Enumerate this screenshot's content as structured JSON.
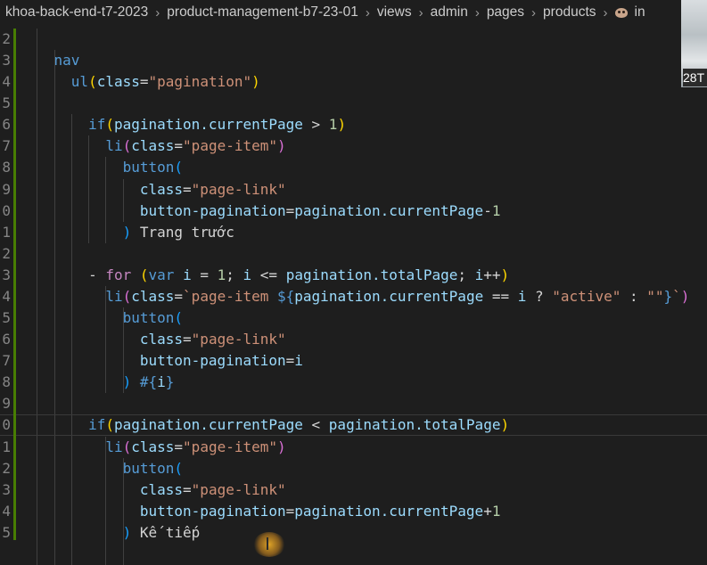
{
  "breadcrumb": {
    "items": [
      "khoa-back-end-t7-2023",
      "product-management-b7-23-01",
      "views",
      "admin",
      "pages",
      "products"
    ],
    "file_prefix": "in"
  },
  "overlay": {
    "label": "28T"
  },
  "editor": {
    "lines": [
      {
        "num": "2",
        "segs": []
      },
      {
        "num": "3",
        "segs": [
          [
            "    ",
            "tx"
          ],
          [
            "nav",
            "t"
          ]
        ]
      },
      {
        "num": "4",
        "segs": [
          [
            "      ",
            "tx"
          ],
          [
            "ul",
            "t"
          ],
          [
            "(",
            "y"
          ],
          [
            "class",
            "a"
          ],
          [
            "=",
            "tx"
          ],
          [
            "\"pagination\"",
            "s"
          ],
          [
            ")",
            "y"
          ]
        ]
      },
      {
        "num": "5",
        "segs": []
      },
      {
        "num": "6",
        "segs": [
          [
            "        ",
            "tx"
          ],
          [
            "if",
            "k"
          ],
          [
            "(",
            "y"
          ],
          [
            "pagination.currentPage",
            "a"
          ],
          [
            " > ",
            "tx"
          ],
          [
            "1",
            "n"
          ],
          [
            ")",
            "y"
          ]
        ]
      },
      {
        "num": "7",
        "segs": [
          [
            "          ",
            "tx"
          ],
          [
            "li",
            "t"
          ],
          [
            "(",
            "pl"
          ],
          [
            "class",
            "a"
          ],
          [
            "=",
            "tx"
          ],
          [
            "\"page-item\"",
            "s"
          ],
          [
            ")",
            "pl"
          ]
        ]
      },
      {
        "num": "8",
        "segs": [
          [
            "            ",
            "tx"
          ],
          [
            "button",
            "t"
          ],
          [
            "(",
            "bl"
          ]
        ]
      },
      {
        "num": "9",
        "segs": [
          [
            "              ",
            "tx"
          ],
          [
            "class",
            "a"
          ],
          [
            "=",
            "tx"
          ],
          [
            "\"page-link\"",
            "s"
          ]
        ]
      },
      {
        "num": "0",
        "segs": [
          [
            "              ",
            "tx"
          ],
          [
            "button-pagination",
            "a"
          ],
          [
            "=",
            "tx"
          ],
          [
            "pagination.currentPage",
            "a"
          ],
          [
            "-",
            "tx"
          ],
          [
            "1",
            "n"
          ]
        ]
      },
      {
        "num": "1",
        "segs": [
          [
            "            ",
            "tx"
          ],
          [
            ")",
            "bl"
          ],
          [
            " Trang trước",
            "tx"
          ]
        ]
      },
      {
        "num": "2",
        "segs": []
      },
      {
        "num": "3",
        "segs": [
          [
            "        ",
            "tx"
          ],
          [
            "- ",
            "tx"
          ],
          [
            "for",
            "p"
          ],
          [
            " ",
            "tx"
          ],
          [
            "(",
            "y"
          ],
          [
            "var",
            "k"
          ],
          [
            " ",
            "tx"
          ],
          [
            "i",
            "a"
          ],
          [
            " = ",
            "tx"
          ],
          [
            "1",
            "n"
          ],
          [
            "; ",
            "tx"
          ],
          [
            "i",
            "a"
          ],
          [
            " <= ",
            "tx"
          ],
          [
            "pagination.totalPage",
            "a"
          ],
          [
            "; ",
            "tx"
          ],
          [
            "i",
            "a"
          ],
          [
            "++",
            "tx"
          ],
          [
            ")",
            "y"
          ]
        ]
      },
      {
        "num": "4",
        "segs": [
          [
            "          ",
            "tx"
          ],
          [
            "li",
            "t"
          ],
          [
            "(",
            "pl"
          ],
          [
            "class",
            "a"
          ],
          [
            "=",
            "tx"
          ],
          [
            "`page-item ",
            "s"
          ],
          [
            "${",
            "k"
          ],
          [
            "pagination.currentPage",
            "a"
          ],
          [
            " == ",
            "tx"
          ],
          [
            "i",
            "a"
          ],
          [
            " ? ",
            "tx"
          ],
          [
            "\"active\"",
            "s"
          ],
          [
            " : ",
            "tx"
          ],
          [
            "\"\"",
            "s"
          ],
          [
            "}",
            "k"
          ],
          [
            "`",
            "s"
          ],
          [
            ")",
            "pl"
          ]
        ]
      },
      {
        "num": "5",
        "segs": [
          [
            "            ",
            "tx"
          ],
          [
            "button",
            "t"
          ],
          [
            "(",
            "bl"
          ]
        ]
      },
      {
        "num": "6",
        "segs": [
          [
            "              ",
            "tx"
          ],
          [
            "class",
            "a"
          ],
          [
            "=",
            "tx"
          ],
          [
            "\"page-link\"",
            "s"
          ]
        ]
      },
      {
        "num": "7",
        "segs": [
          [
            "              ",
            "tx"
          ],
          [
            "button-pagination",
            "a"
          ],
          [
            "=",
            "tx"
          ],
          [
            "i",
            "a"
          ]
        ]
      },
      {
        "num": "8",
        "segs": [
          [
            "            ",
            "tx"
          ],
          [
            ")",
            "bl"
          ],
          [
            " #{",
            "k"
          ],
          [
            "i",
            "a"
          ],
          [
            "}",
            "k"
          ]
        ]
      },
      {
        "num": "9",
        "segs": []
      },
      {
        "num": "0",
        "segs": [
          [
            "        ",
            "tx"
          ],
          [
            "if",
            "k"
          ],
          [
            "(",
            "y"
          ],
          [
            "pagination.currentPage",
            "a"
          ],
          [
            " < ",
            "tx"
          ],
          [
            "pagination.totalPage",
            "a"
          ],
          [
            ")",
            "y"
          ]
        ]
      },
      {
        "num": "1",
        "segs": [
          [
            "          ",
            "tx"
          ],
          [
            "li",
            "t"
          ],
          [
            "(",
            "pl"
          ],
          [
            "class",
            "a"
          ],
          [
            "=",
            "tx"
          ],
          [
            "\"page-item\"",
            "s"
          ],
          [
            ")",
            "pl"
          ]
        ]
      },
      {
        "num": "2",
        "segs": [
          [
            "            ",
            "tx"
          ],
          [
            "button",
            "t"
          ],
          [
            "(",
            "bl"
          ]
        ]
      },
      {
        "num": "3",
        "segs": [
          [
            "              ",
            "tx"
          ],
          [
            "class",
            "a"
          ],
          [
            "=",
            "tx"
          ],
          [
            "\"page-link\"",
            "s"
          ]
        ]
      },
      {
        "num": "4",
        "segs": [
          [
            "              ",
            "tx"
          ],
          [
            "button-pagination",
            "a"
          ],
          [
            "=",
            "tx"
          ],
          [
            "pagination.currentPage",
            "a"
          ],
          [
            "+",
            "tx"
          ],
          [
            "1",
            "n"
          ]
        ]
      },
      {
        "num": "5",
        "segs": [
          [
            "            ",
            "tx"
          ],
          [
            ")",
            "bl"
          ],
          [
            " Kế tiếp",
            "tx"
          ]
        ]
      }
    ]
  },
  "theme": {
    "background": "#1e1e1e",
    "git_added": "#487e02",
    "cursor_highlight": "#f0a020"
  }
}
